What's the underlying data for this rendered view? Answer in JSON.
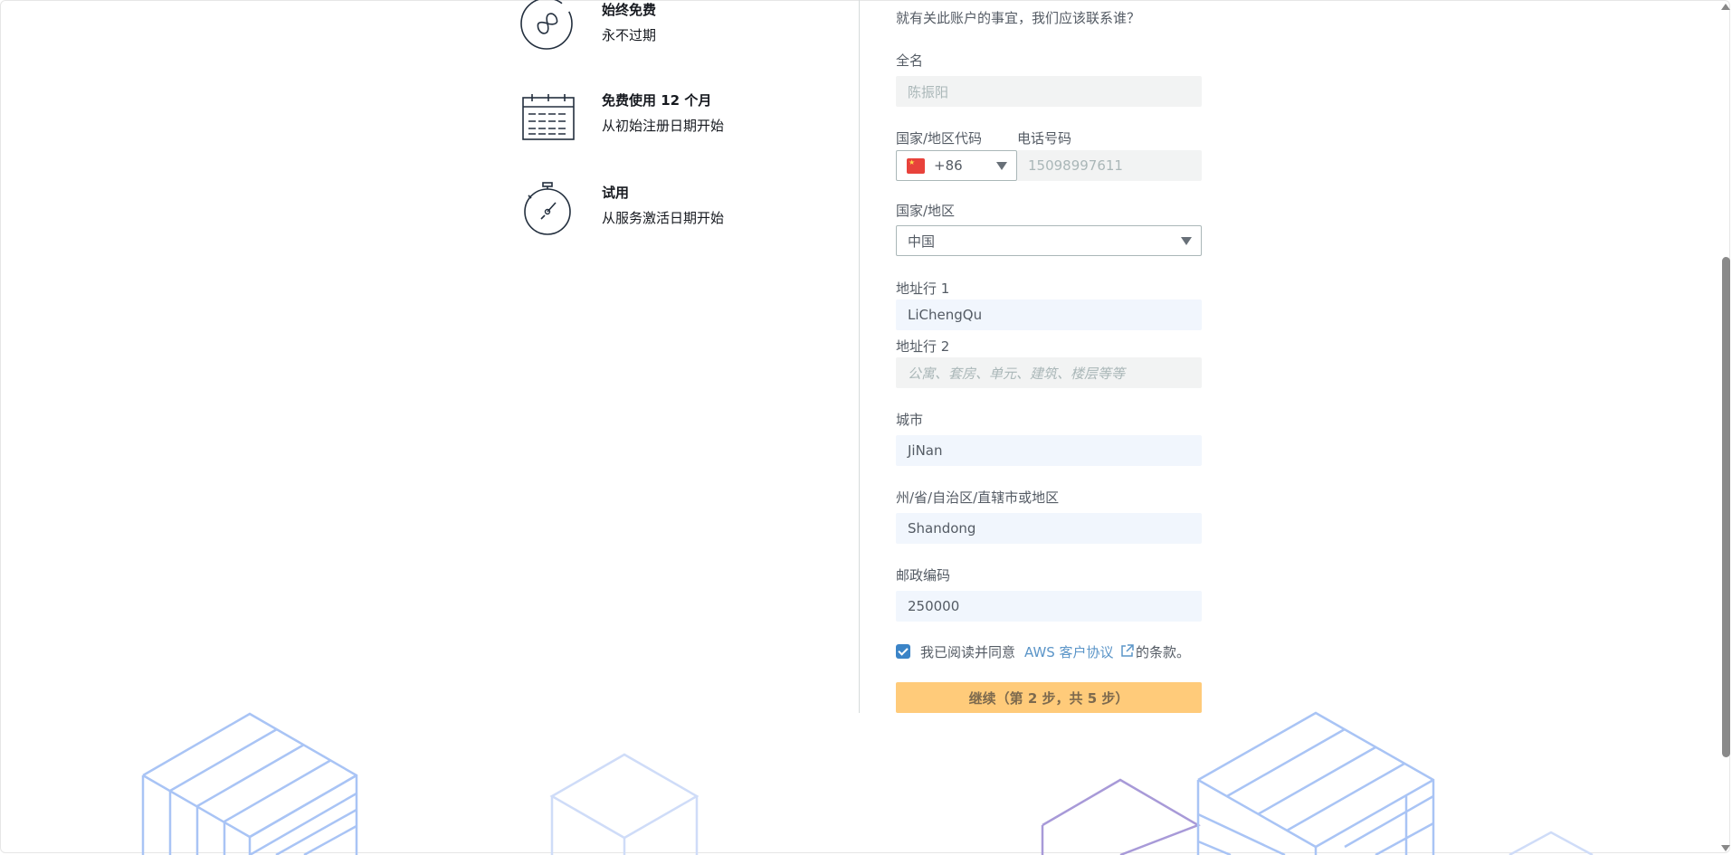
{
  "benefits": [
    {
      "icon": "infinity-icon",
      "title": "始终免费",
      "subtitle": "永不过期"
    },
    {
      "icon": "calendar-icon",
      "title": "免费使用 12 个月",
      "subtitle": "从初始注册日期开始"
    },
    {
      "icon": "stopwatch-icon",
      "title": "试用",
      "subtitle": "从服务激活日期开始"
    }
  ],
  "form": {
    "intro": "就有关此账户的事宜，我们应该联系谁？",
    "full_name": {
      "label": "全名",
      "value": "陈振阳"
    },
    "country_code": {
      "label": "国家/地区代码",
      "value": "+86",
      "flag": "china-flag-icon"
    },
    "phone": {
      "label": "电话号码",
      "value": "15098997611"
    },
    "country": {
      "label": "国家/地区",
      "value": "中国"
    },
    "address1": {
      "label": "地址行 1",
      "value": "LiChengQu"
    },
    "address2": {
      "label": "地址行 2",
      "placeholder": "公寓、套房、单元、建筑、楼层等等"
    },
    "city": {
      "label": "城市",
      "value": "JiNan"
    },
    "state": {
      "label": "州/省/自治区/直辖市或地区",
      "value": "Shandong"
    },
    "postal": {
      "label": "邮政编码",
      "value": "250000"
    },
    "agreement": {
      "checked": true,
      "prefix": "我已阅读并同意",
      "link": "AWS 客户协议",
      "suffix": "的条款。"
    },
    "continue_label": "继续（第 2 步，共 5 步）"
  },
  "colors": {
    "button": "#ffcb7a",
    "link": "#5b95c8",
    "checkbox": "#3b84c7",
    "deco_blue": "#a9c4f5",
    "deco_purple": "#a89ad8"
  }
}
